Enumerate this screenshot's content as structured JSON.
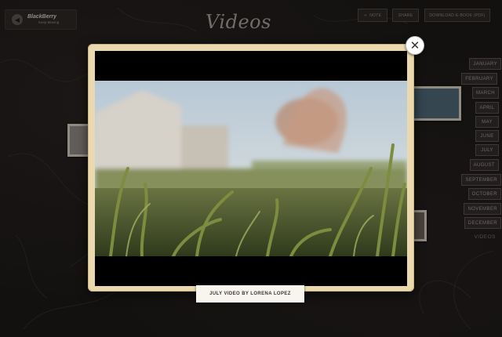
{
  "brand": {
    "name": "BlackBerry",
    "tagline": "Keep Moving"
  },
  "header": {
    "title": "Videos",
    "buttons": [
      {
        "label": "Note",
        "icon": "share-icon"
      },
      {
        "label": "Share"
      },
      {
        "label": "Download E-Book (PDF)"
      }
    ]
  },
  "months": [
    "January",
    "February",
    "March",
    "April",
    "May",
    "June",
    "July",
    "August",
    "September",
    "October",
    "November",
    "December"
  ],
  "current_section": "Videos",
  "video": {
    "caption": "July Video by Lorena Lopez",
    "close_icon": "close-icon"
  }
}
